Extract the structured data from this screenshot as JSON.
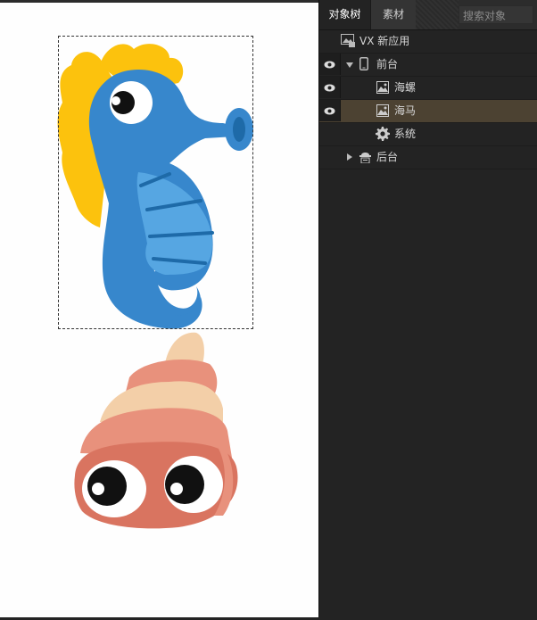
{
  "tabs": {
    "tree": "对象树",
    "assets": "素材"
  },
  "search": {
    "placeholder": "搜索对象"
  },
  "tree": {
    "app": "VX 新应用",
    "frontend": "前台",
    "items": [
      "海螺",
      "海马",
      "系统"
    ],
    "backend": "后台"
  },
  "colors": {
    "panel_bg": "#232323",
    "selected_row": "#4c4232",
    "seahorse_body": "#3787cc",
    "seahorse_belly": "#56a6e2",
    "seahorse_fin": "#fcc20d",
    "conch_pink": "#e8917c",
    "conch_cream": "#f3cfa8"
  }
}
